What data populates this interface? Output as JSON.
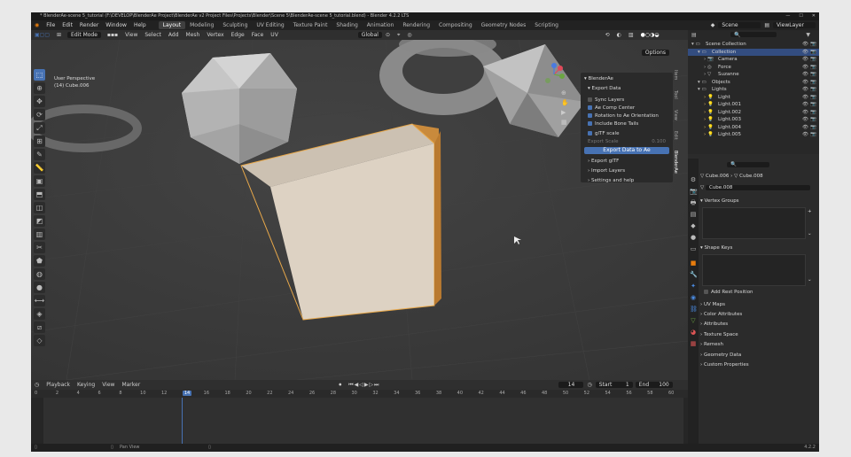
{
  "window": {
    "title": "* BlenderAe-scene 5_tutorial (F:\\DEVELOP\\BlenderAe Project\\BlenderAe v2 Project Files\\Projects\\Blender\\Scene 5\\BlenderAe-scene 5_tutorial.blend) - Blender 4.2.2 LTS"
  },
  "menubar": {
    "menus": [
      "File",
      "Edit",
      "Render",
      "Window",
      "Help"
    ],
    "workspaces": [
      "Layout",
      "Modeling",
      "Sculpting",
      "UV Editing",
      "Texture Paint",
      "Shading",
      "Animation",
      "Rendering",
      "Compositing",
      "Geometry Nodes",
      "Scripting"
    ],
    "scene": "Scene",
    "view_layer": "ViewLayer"
  },
  "viewport_header": {
    "mode": "Edit Mode",
    "menus": [
      "View",
      "Select",
      "Add",
      "Mesh",
      "Vertex",
      "Edge",
      "Face",
      "UV"
    ],
    "orientation": "Global",
    "options": "Options"
  },
  "viewport": {
    "perspective": "User Perspective",
    "object": "(14) Cube.006"
  },
  "blenderae_panel": {
    "title": "BlenderAe",
    "section": "Export Data",
    "sync_layers": "Sync Layers",
    "checkboxes": [
      {
        "label": "Ae Comp Center",
        "checked": true
      },
      {
        "label": "Rotation to Ae Orientation",
        "checked": true
      },
      {
        "label": "Include Bone Tails",
        "checked": true
      },
      {
        "label": "glTF scale",
        "checked": true
      }
    ],
    "export_scale_label": "Export Scale",
    "export_scale_value": "0.100",
    "export_button": "Export Data to Ae",
    "subpanels": [
      "Export glTF",
      "Import Layers",
      "Settings and help"
    ]
  },
  "sidebar_tabs": [
    "Item",
    "Tool",
    "View",
    "Edit",
    "BlenderAe"
  ],
  "outliner": {
    "search_placeholder": "",
    "rows": [
      {
        "label": "Scene Collection",
        "depth": 0
      },
      {
        "label": "Collection",
        "depth": 1
      },
      {
        "label": "Camera",
        "depth": 2
      },
      {
        "label": "Force",
        "depth": 2
      },
      {
        "label": "Suzanne",
        "depth": 2
      },
      {
        "label": "Objects",
        "depth": 1
      },
      {
        "label": "Lights",
        "depth": 1
      },
      {
        "label": "Light",
        "depth": 2
      },
      {
        "label": "Light.001",
        "depth": 2
      },
      {
        "label": "Light.002",
        "depth": 2
      },
      {
        "label": "Light.003",
        "depth": 2
      },
      {
        "label": "Light.004",
        "depth": 2
      },
      {
        "label": "Light.005",
        "depth": 2
      }
    ]
  },
  "properties": {
    "breadcrumb": [
      "Cube.006",
      "Cube.008"
    ],
    "mesh_name": "Cube.008",
    "sections": {
      "vertex_groups": "Vertex Groups",
      "shape_keys": "Shape Keys",
      "add_rest_position": "Add Rest Position"
    },
    "collapsed": [
      "UV Maps",
      "Color Attributes",
      "Attributes",
      "Texture Space",
      "Remesh",
      "Geometry Data",
      "Custom Properties"
    ]
  },
  "timeline": {
    "menus": [
      "Playback",
      "Keying",
      "View",
      "Marker"
    ],
    "current_frame": "14",
    "start_label": "Start",
    "start": "1",
    "end_label": "End",
    "end": "100",
    "ruler": [
      "0",
      "2",
      "4",
      "6",
      "8",
      "10",
      "12",
      "14",
      "16",
      "18",
      "20",
      "22",
      "24",
      "26",
      "28",
      "30",
      "32",
      "34",
      "36",
      "38",
      "40",
      "42",
      "44",
      "46",
      "48",
      "50",
      "52",
      "54",
      "56",
      "58",
      "60"
    ]
  },
  "statusbar": {
    "hint": "Pan View",
    "version": "4.2.2"
  },
  "colors": {
    "accent": "#4772b3",
    "cube_face": "#ddd2c3",
    "cube_side": "#c98a3c"
  }
}
